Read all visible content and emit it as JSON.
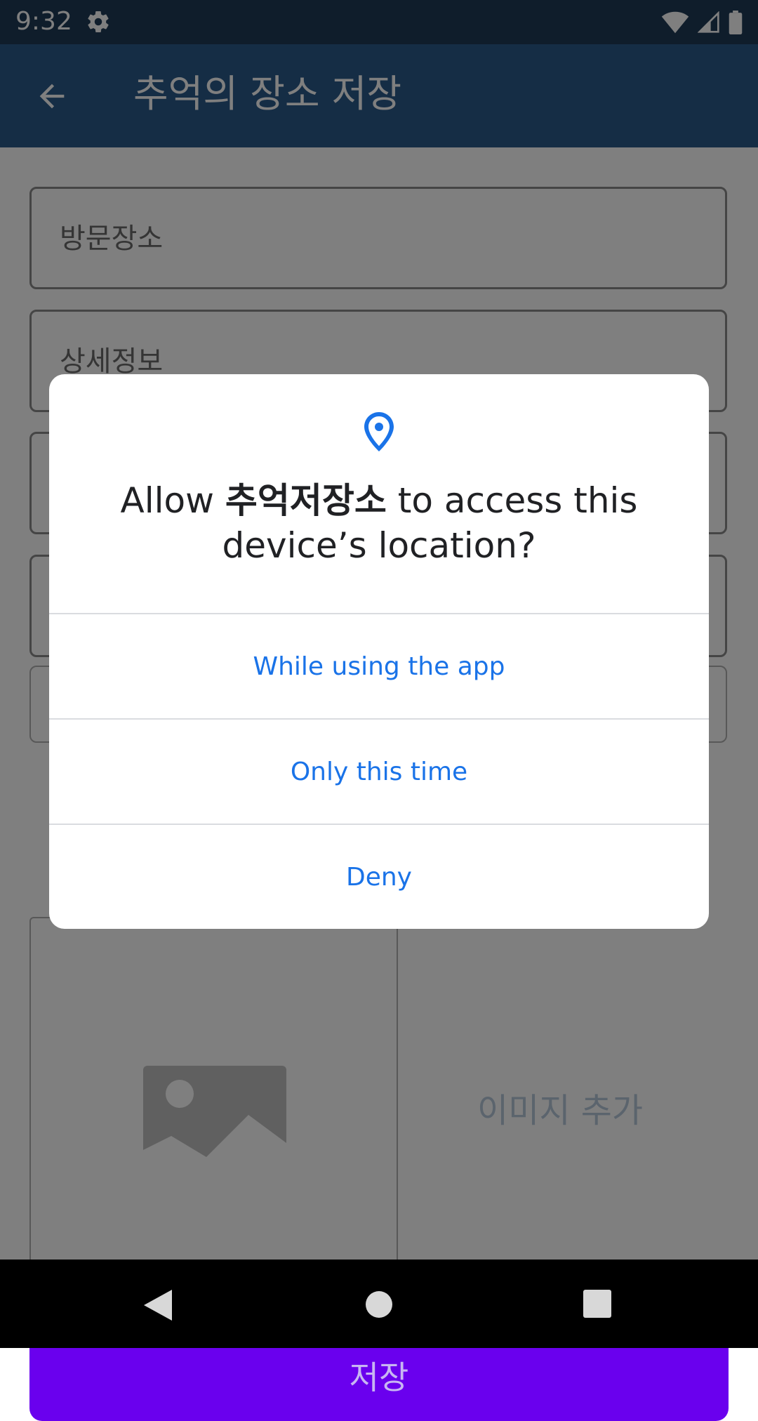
{
  "status_bar": {
    "time": "9:32",
    "icons": [
      "gear-icon",
      "wifi-icon",
      "signal-icon",
      "battery-icon"
    ]
  },
  "app_bar": {
    "title": "추억의 장소 저장",
    "back_icon": "arrow-left-icon"
  },
  "form": {
    "visit_place_placeholder": "방문장소",
    "detail_placeholder": "상세정보",
    "add_image_label": "이미지 추가",
    "save_label": "저장"
  },
  "dialog": {
    "icon": "location-pin-icon",
    "title_prefix": "Allow ",
    "app_name": "추억저장소",
    "title_suffix": " to access this device’s location?",
    "options": [
      "While using the app",
      "Only this time",
      "Deny"
    ]
  },
  "colors": {
    "accent": "#1a73e8",
    "app_bar": "#2a5a8a",
    "save_button": "#6a00ee"
  }
}
